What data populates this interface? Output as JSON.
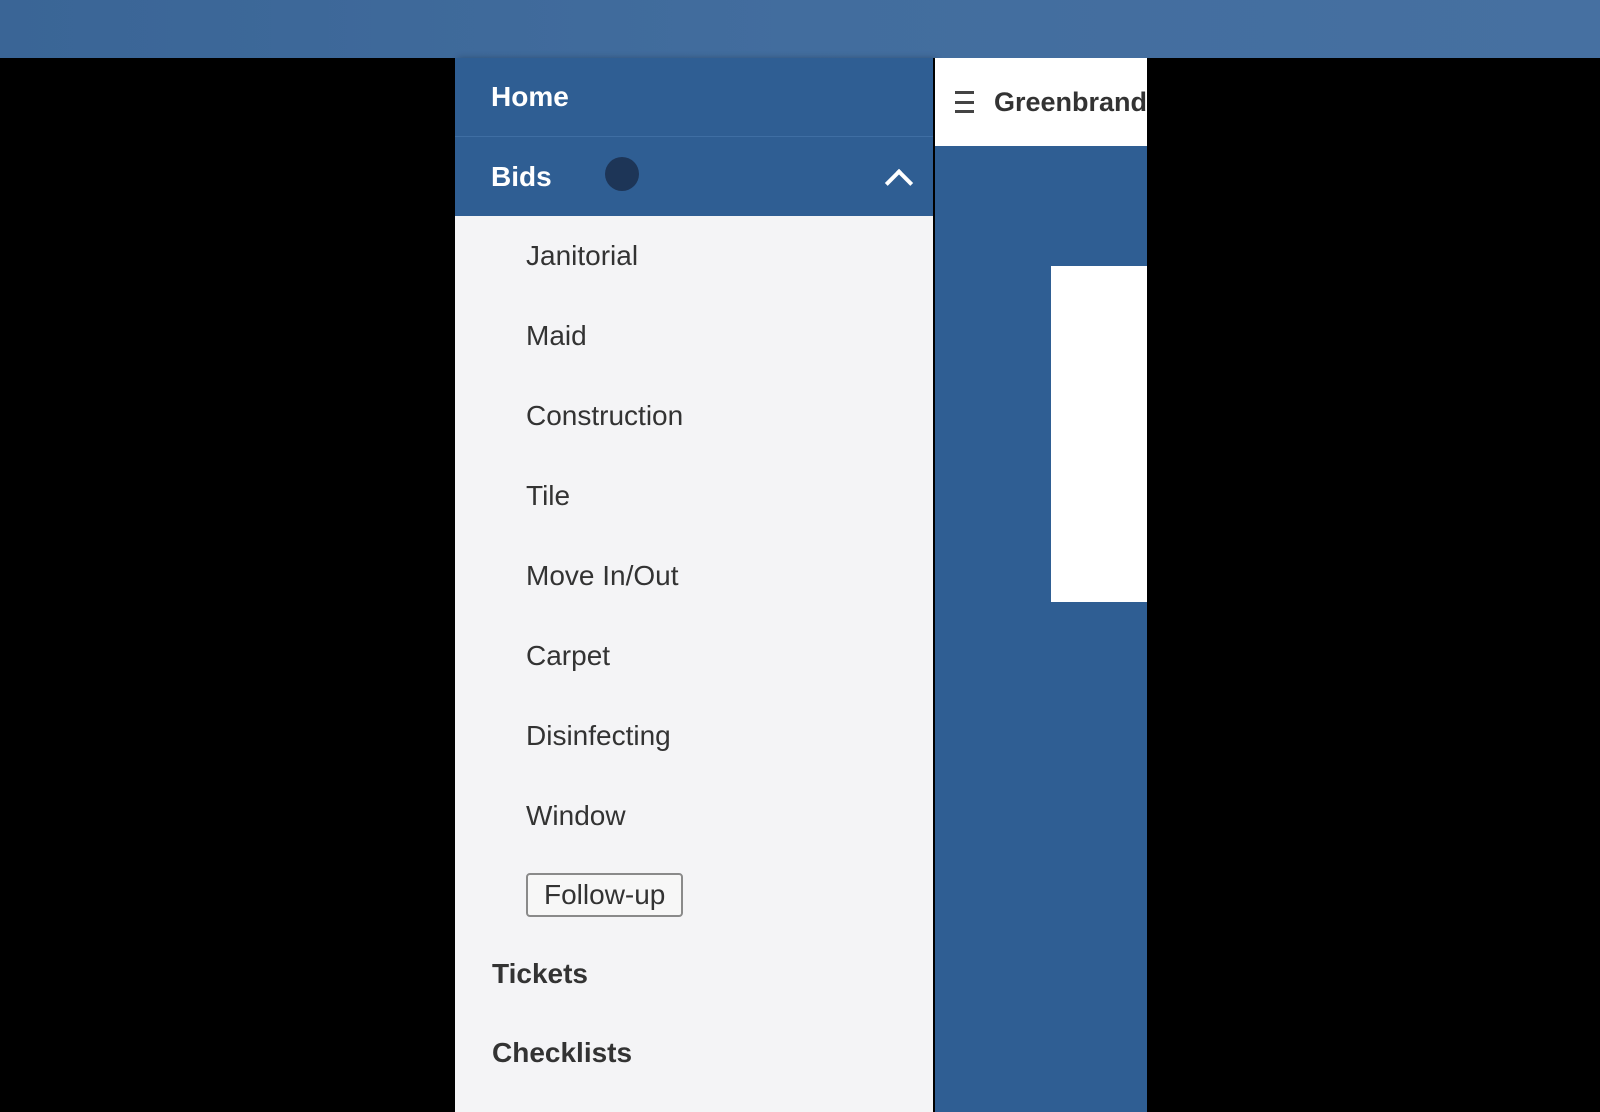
{
  "menu": {
    "home_label": "Home",
    "bids_label": "Bids",
    "bids_items": [
      "Janitorial",
      "Maid",
      "Construction",
      "Tile",
      "Move In/Out",
      "Carpet",
      "Disinfecting",
      "Window"
    ],
    "followup_label": "Follow-up",
    "tickets_label": "Tickets",
    "checklists_label": "Checklists"
  },
  "header": {
    "brand": "Greenbrand",
    "menu_icon": "hamburger-icon"
  },
  "colors": {
    "primary": "#2f5e93",
    "menu_background": "#f4f4f6",
    "text": "#333333"
  }
}
